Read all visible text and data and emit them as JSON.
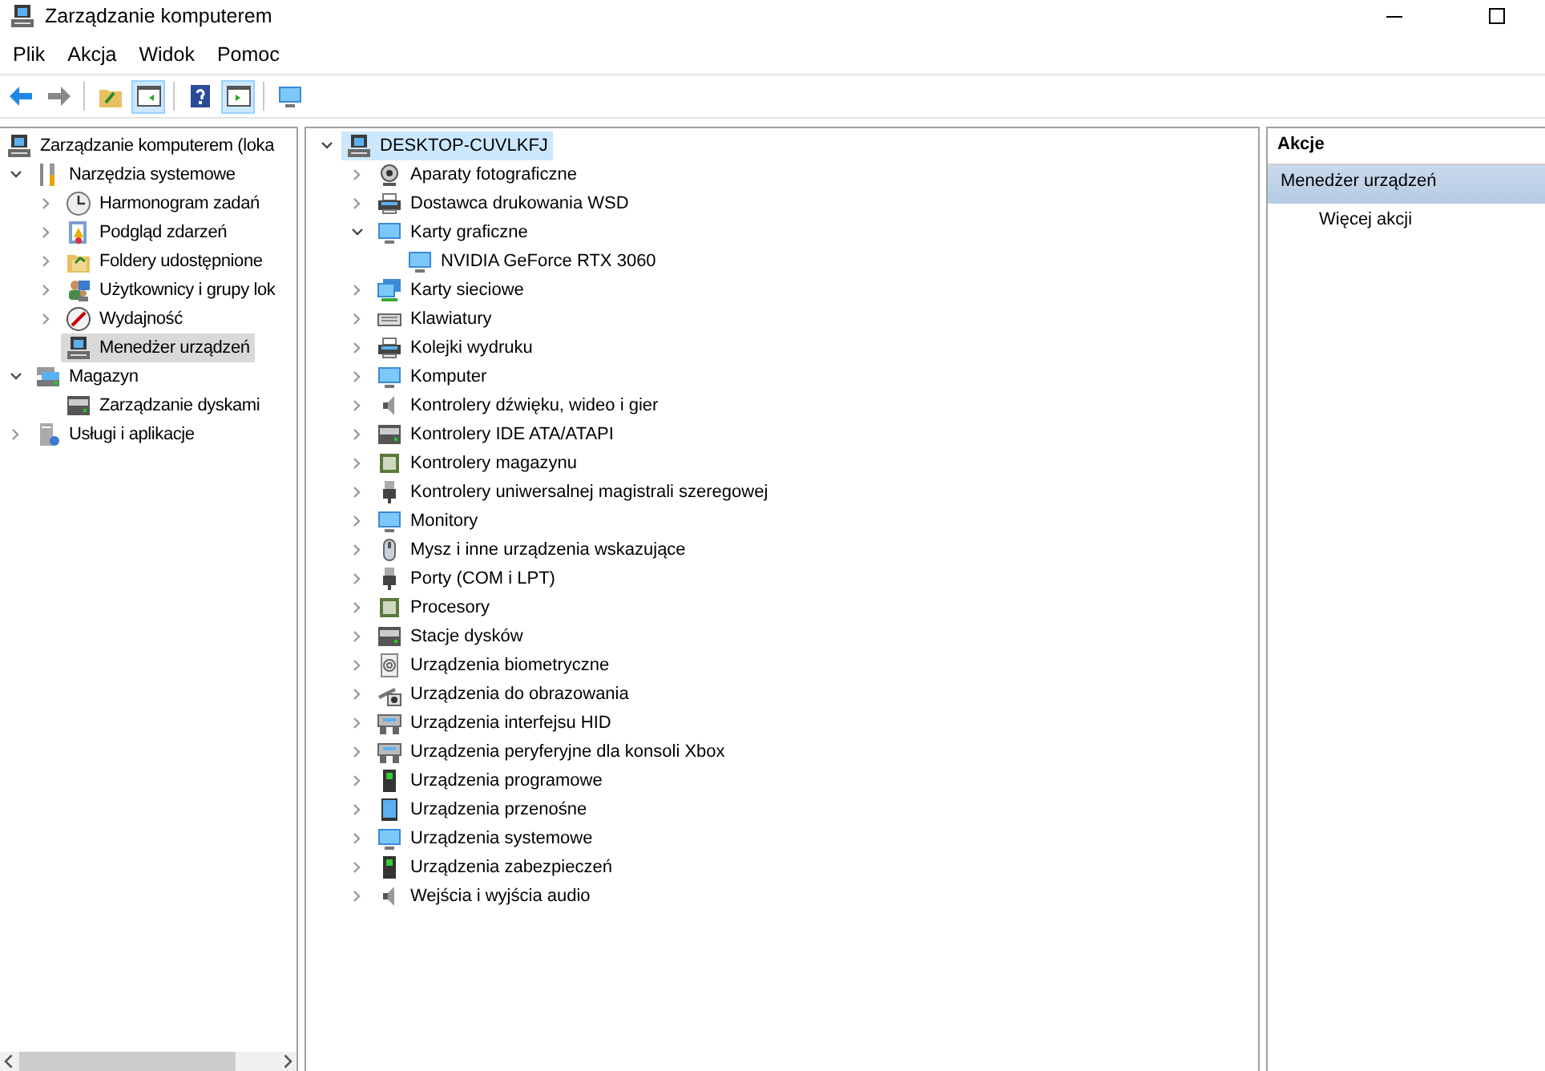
{
  "window": {
    "title": "Zarządzanie komputerem"
  },
  "menu": [
    "Plik",
    "Akcja",
    "Widok",
    "Pomoc"
  ],
  "toolbar": [
    {
      "pressed": false
    },
    {
      "pressed": false
    },
    {
      "pressed": false
    },
    {
      "pressed": true
    },
    {
      "pressed": false
    },
    {
      "pressed": true
    },
    {
      "pressed": false
    }
  ],
  "navigation_tree": [
    {
      "label": "Zarządzanie komputerem (loka",
      "selected": false,
      "children": [
        {
          "label": "Narzędzia systemowe",
          "selected": false,
          "expanded": true,
          "children": [
            {
              "label": "Harmonogram zadań",
              "selected": false,
              "expanded": false
            },
            {
              "label": "Podgląd zdarzeń",
              "selected": false,
              "expanded": false
            },
            {
              "label": "Foldery udostępnione",
              "selected": false,
              "expanded": false
            },
            {
              "label": "Użytkownicy i grupy lok",
              "selected": false,
              "expanded": false
            },
            {
              "label": "Wydajność",
              "selected": false,
              "expanded": false
            },
            {
              "label": "Menedżer urządzeń",
              "selected": true
            }
          ]
        },
        {
          "label": "Magazyn",
          "selected": false,
          "expanded": true,
          "children": [
            {
              "label": "Zarządzanie dyskami",
              "selected": false
            }
          ]
        },
        {
          "label": "Usługi i aplikacje",
          "selected": false,
          "expanded": false
        }
      ]
    }
  ],
  "device_tree": [
    {
      "label": "DESKTOP-CUVLKFJ",
      "selected": true,
      "expanded": true,
      "children": [
        {
          "label": "Aparaty fotograficzne",
          "selected": false,
          "expanded": false
        },
        {
          "label": "Dostawca drukowania WSD",
          "selected": false,
          "expanded": false
        },
        {
          "label": "Karty graficzne",
          "selected": false,
          "expanded": true,
          "children": [
            {
              "label": "NVIDIA GeForce RTX 3060",
              "selected": false
            }
          ]
        },
        {
          "label": "Karty sieciowe",
          "selected": false,
          "expanded": false
        },
        {
          "label": "Klawiatury",
          "selected": false,
          "expanded": false
        },
        {
          "label": "Kolejki wydruku",
          "selected": false,
          "expanded": false
        },
        {
          "label": "Komputer",
          "selected": false,
          "expanded": false
        },
        {
          "label": "Kontrolery dźwięku, wideo i gier",
          "selected": false,
          "expanded": false
        },
        {
          "label": "Kontrolery IDE ATA/ATAPI",
          "selected": false,
          "expanded": false
        },
        {
          "label": "Kontrolery magazynu",
          "selected": false,
          "expanded": false
        },
        {
          "label": "Kontrolery uniwersalnej magistrali szeregowej",
          "selected": false,
          "expanded": false
        },
        {
          "label": "Monitory",
          "selected": false,
          "expanded": false
        },
        {
          "label": "Mysz i inne urządzenia wskazujące",
          "selected": false,
          "expanded": false
        },
        {
          "label": "Porty (COM i LPT)",
          "selected": false,
          "expanded": false
        },
        {
          "label": "Procesory",
          "selected": false,
          "expanded": false
        },
        {
          "label": "Stacje dysków",
          "selected": false,
          "expanded": false
        },
        {
          "label": "Urządzenia biometryczne",
          "selected": false,
          "expanded": false
        },
        {
          "label": "Urządzenia do obrazowania",
          "selected": false,
          "expanded": false
        },
        {
          "label": "Urządzenia interfejsu HID",
          "selected": false,
          "expanded": false
        },
        {
          "label": "Urządzenia peryferyjne dla konsoli Xbox",
          "selected": false,
          "expanded": false
        },
        {
          "label": "Urządzenia programowe",
          "selected": false,
          "expanded": false
        },
        {
          "label": "Urządzenia przenośne",
          "selected": false,
          "expanded": false
        },
        {
          "label": "Urządzenia systemowe",
          "selected": false,
          "expanded": false
        },
        {
          "label": "Urządzenia zabezpieczeń",
          "selected": false,
          "expanded": false
        },
        {
          "label": "Wejścia i wyjścia audio",
          "selected": false,
          "expanded": false
        }
      ]
    }
  ],
  "actions": {
    "title": "Akcje",
    "items": [
      {
        "label": "Menedżer urządzeń",
        "kind": "section"
      },
      {
        "label": "Więcej akcji",
        "kind": "action"
      }
    ]
  }
}
